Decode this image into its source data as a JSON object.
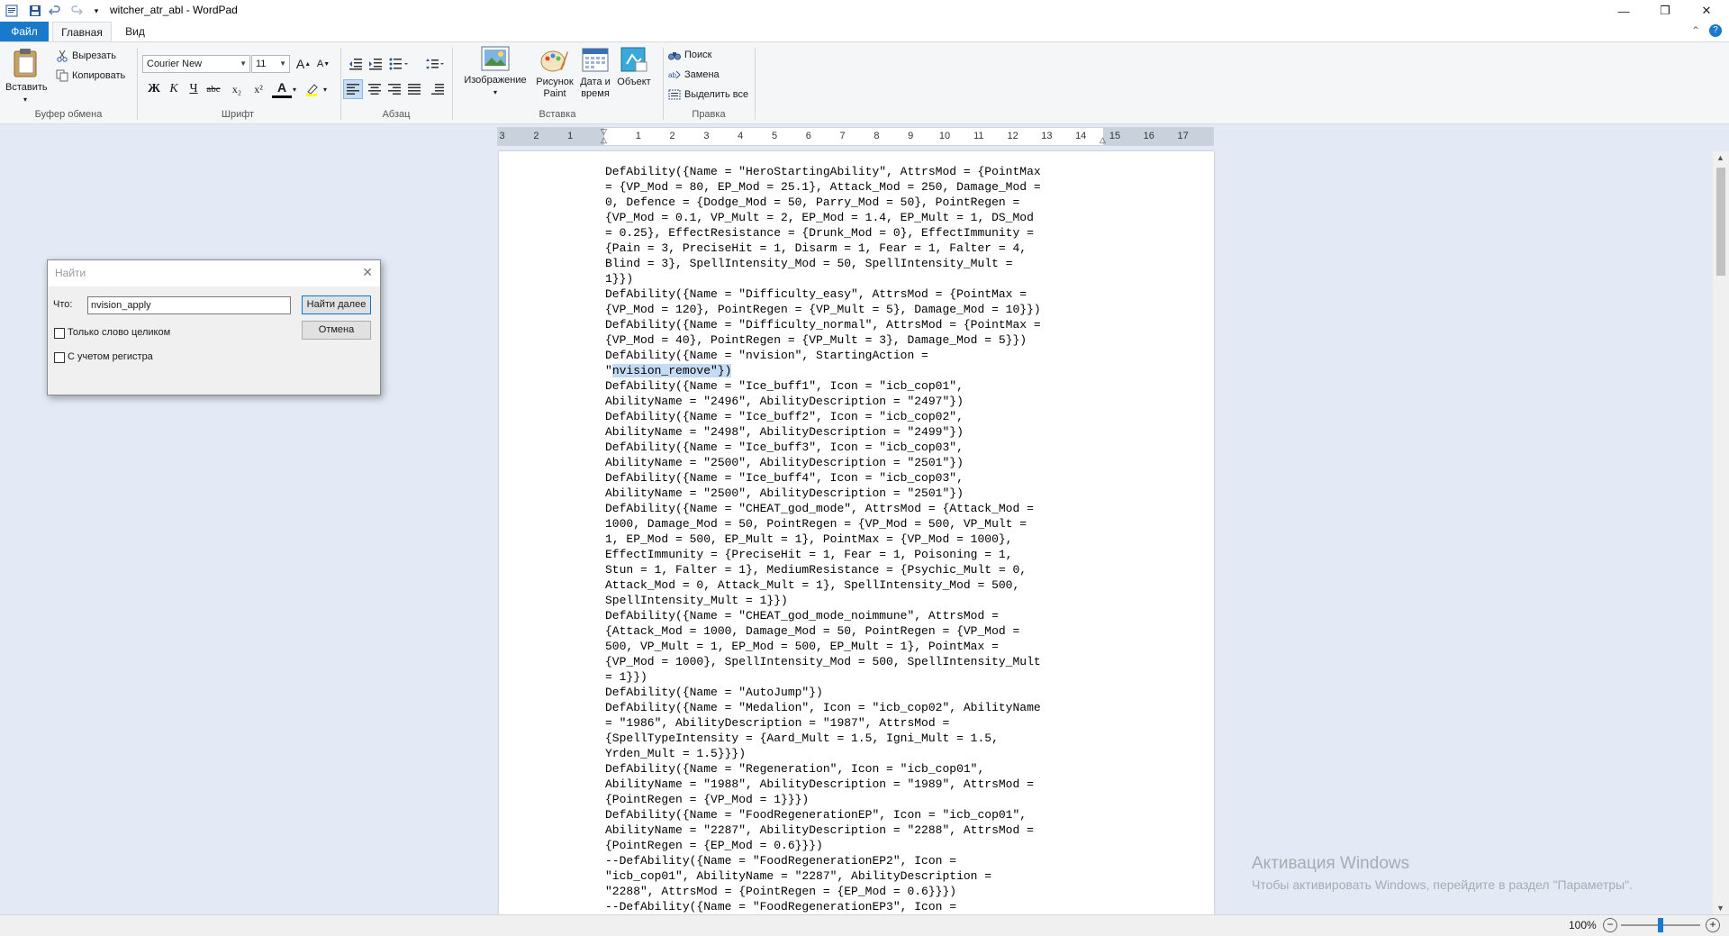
{
  "window": {
    "title": "witcher_atr_abl - WordPad",
    "minimize_glyph": "—",
    "maximize_glyph": "❐",
    "close_glyph": "✕",
    "help_glyph": "?",
    "collapse_glyph": "⌃"
  },
  "quick_access": {
    "icons": [
      "wordpad-app-icon",
      "save-icon",
      "undo-icon",
      "redo-icon",
      "customize-dropdown-icon"
    ]
  },
  "tabs": {
    "file": "Файл",
    "home": "Главная",
    "view": "Вид"
  },
  "ribbon": {
    "clipboard": {
      "paste": "Вставить",
      "cut": "Вырезать",
      "copy": "Копировать",
      "group": "Буфер обмена"
    },
    "font": {
      "family": "Courier New",
      "size": "11",
      "grow": "A",
      "shrink": "A",
      "bold": "Ж",
      "italic": "К",
      "underline": "Ч",
      "strike": "abc",
      "subscript": "x₂",
      "superscript": "x²",
      "color": "A",
      "group": "Шрифт"
    },
    "paragraph": {
      "group": "Абзац"
    },
    "insert": {
      "image": "Изображение",
      "paint_line1": "Рисунок",
      "paint_line2": "Paint",
      "datetime_line1": "Дата и",
      "datetime_line2": "время",
      "object": "Объект",
      "group": "Вставка"
    },
    "editing": {
      "find": "Поиск",
      "replace": "Замена",
      "select_all": "Выделить все",
      "group": "Правка"
    }
  },
  "ruler": {
    "ticks": [
      "3",
      "2",
      "1",
      "1",
      "2",
      "3",
      "4",
      "5",
      "6",
      "7",
      "8",
      "9",
      "10",
      "11",
      "12",
      "13",
      "14",
      "15",
      "16",
      "17"
    ]
  },
  "document": {
    "text_before": "DefAbility({Name = \"HeroStartingAbility\", AttrsMod = {PointMax\n= {VP_Mod = 80, EP_Mod = 25.1}, Attack_Mod = 250, Damage_Mod =\n0, Defence = {Dodge_Mod = 50, Parry_Mod = 50}, PointRegen =\n{VP_Mod = 0.1, VP_Mult = 2, EP_Mod = 1.4, EP_Mult = 1, DS_Mod\n= 0.25}, EffectResistance = {Drunk_Mod = 0}, EffectImmunity =\n{Pain = 3, PreciseHit = 1, Disarm = 1, Fear = 1, Falter = 4,\nBlind = 3}, SpellIntensity_Mod = 50, SpellIntensity_Mult =\n1}})\nDefAbility({Name = \"Difficulty_easy\", AttrsMod = {PointMax =\n{VP_Mod = 120}, PointRegen = {VP_Mult = 5}, Damage_Mod = 10}})\nDefAbility({Name = \"Difficulty_normal\", AttrsMod = {PointMax =\n{VP_Mod = 40}, PointRegen = {VP_Mult = 3}, Damage_Mod = 5}})\nDefAbility({Name = \"nvision\", StartingAction =\n\"",
    "highlight": "nvision_remove\"})",
    "text_after": "\nDefAbility({Name = \"Ice_buff1\", Icon = \"icb_cop01\",\nAbilityName = \"2496\", AbilityDescription = \"2497\"})\nDefAbility({Name = \"Ice_buff2\", Icon = \"icb_cop02\",\nAbilityName = \"2498\", AbilityDescription = \"2499\"})\nDefAbility({Name = \"Ice_buff3\", Icon = \"icb_cop03\",\nAbilityName = \"2500\", AbilityDescription = \"2501\"})\nDefAbility({Name = \"Ice_buff4\", Icon = \"icb_cop03\",\nAbilityName = \"2500\", AbilityDescription = \"2501\"})\nDefAbility({Name = \"CHEAT_god_mode\", AttrsMod = {Attack_Mod =\n1000, Damage_Mod = 50, PointRegen = {VP_Mod = 500, VP_Mult =\n1, EP_Mod = 500, EP_Mult = 1}, PointMax = {VP_Mod = 1000},\nEffectImmunity = {PreciseHit = 1, Fear = 1, Poisoning = 1,\nStun = 1, Falter = 1}, MediumResistance = {Psychic_Mult = 0,\nAttack_Mod = 0, Attack_Mult = 1}, SpellIntensity_Mod = 500,\nSpellIntensity_Mult = 1}})\nDefAbility({Name = \"CHEAT_god_mode_noimmune\", AttrsMod =\n{Attack_Mod = 1000, Damage_Mod = 50, PointRegen = {VP_Mod =\n500, VP_Mult = 1, EP_Mod = 500, EP_Mult = 1}, PointMax =\n{VP_Mod = 1000}, SpellIntensity_Mod = 500, SpellIntensity_Mult\n= 1}})\nDefAbility({Name = \"AutoJump\"})\nDefAbility({Name = \"Medalion\", Icon = \"icb_cop02\", AbilityName\n= \"1986\", AbilityDescription = \"1987\", AttrsMod =\n{SpellTypeIntensity = {Aard_Mult = 1.5, Igni_Mult = 1.5,\nYrden_Mult = 1.5}}})\nDefAbility({Name = \"Regeneration\", Icon = \"icb_cop01\",\nAbilityName = \"1988\", AbilityDescription = \"1989\", AttrsMod =\n{PointRegen = {VP_Mod = 1}}})\nDefAbility({Name = \"FoodRegenerationEP\", Icon = \"icb_cop01\",\nAbilityName = \"2287\", AbilityDescription = \"2288\", AttrsMod =\n{PointRegen = {EP_Mod = 0.6}}})\n--DefAbility({Name = \"FoodRegenerationEP2\", Icon =\n\"icb_cop01\", AbilityName = \"2287\", AbilityDescription =\n\"2288\", AttrsMod = {PointRegen = {EP_Mod = 0.6}}})\n--DefAbility({Name = \"FoodRegenerationEP3\", Icon ="
  },
  "find_dialog": {
    "title": "Найти",
    "what_label": "Что:",
    "query": "nvision_apply",
    "whole_word": "Только слово целиком",
    "match_case": "С учетом регистра",
    "find_next": "Найти далее",
    "cancel": "Отмена",
    "whole_word_checked": false,
    "match_case_checked": false
  },
  "activation": {
    "title": "Активация Windows",
    "message": "Чтобы активировать Windows, перейдите в раздел \"Параметры\"."
  },
  "status": {
    "zoom": "100%",
    "zoom_minus": "−",
    "zoom_plus": "+",
    "zoom_level": 1.0
  },
  "colors": {
    "accent": "#1979ca",
    "highlight": "#c5dbf3",
    "workspace": "#e3eaf5"
  }
}
